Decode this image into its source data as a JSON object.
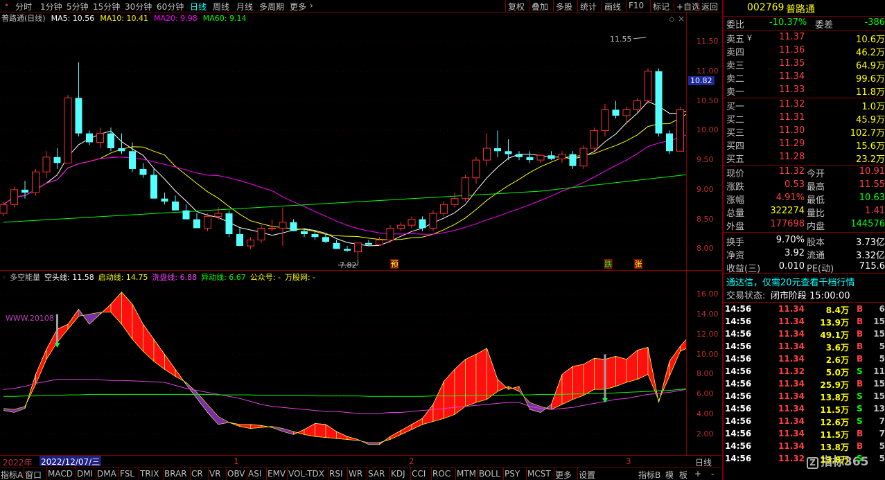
{
  "periods": [
    "分时",
    "1分钟",
    "5分钟",
    "15分钟",
    "30分钟",
    "60分钟",
    "日线",
    "周线",
    "月线",
    "多周期",
    "更多"
  ],
  "active_period": "日线",
  "tools": [
    "复权",
    "叠加",
    "多股",
    "统计",
    "画线",
    "F10",
    "标记",
    "+自选",
    "返回"
  ],
  "main_legend": {
    "name": "普路通(日线)",
    "ma5": "MA5: 10.56",
    "ma10": "MA10: 10.41",
    "ma20": "MA20: 9.98",
    "ma60": "MA60: 9.14"
  },
  "annotations": {
    "high": "11.55",
    "low": "7.82",
    "yu": "预",
    "die": "跌",
    "zhang": "张",
    "price_tag": "10.82"
  },
  "main_yticks": [
    "11.50",
    "11.00",
    "10.50",
    "10.00",
    "9.50",
    "9.00",
    "8.50",
    "8.00"
  ],
  "ind_yticks": [
    "16.00",
    "14.00",
    "12.00",
    "10.00",
    "8.00",
    "6.00",
    "4.00",
    "2.00"
  ],
  "ind_legend": {
    "name": "多空能量",
    "kongtou": "空头线: 11.58",
    "qidong": "启动线: 14.75",
    "xipan": "洗盘线: 6.88",
    "yidong": "异动线: 6.67",
    "gongzhong": "公众号: -",
    "wangu": "万股网: -",
    "watermark": "WWW.20108"
  },
  "timebar": {
    "year": "2022年",
    "date": "2022/12/07/三",
    "m1": "1",
    "m2": "2",
    "m3": "3",
    "period_label": "日线"
  },
  "tabs": [
    "指标A",
    "窗口",
    "MACD",
    "DMI",
    "DMA",
    "FSL",
    "TRIX",
    "BRAR",
    "CR",
    "VR",
    "OBV",
    "ASI",
    "EMV",
    "VOL-TDX",
    "RSI",
    "WR",
    "SAR",
    "KDJ",
    "CCI",
    "ROC",
    "MTM",
    "BOLL",
    "PSY",
    "MCST",
    "更多",
    "设置"
  ],
  "tabs_right": [
    "指标B",
    "模",
    "板",
    "+",
    "-"
  ],
  "stock": {
    "code": "002769",
    "name": "普路通"
  },
  "weibi": {
    "label": "委比",
    "value": "-10.37%",
    "label2": "委差",
    "value2": "-386"
  },
  "asks": [
    {
      "label": "卖五",
      "mark": "￥",
      "price": "11.37",
      "vol": "10.6万"
    },
    {
      "label": "卖四",
      "mark": "",
      "price": "11.36",
      "vol": "46.2万"
    },
    {
      "label": "卖三",
      "mark": "",
      "price": "11.35",
      "vol": "64.9万"
    },
    {
      "label": "卖二",
      "mark": "",
      "price": "11.34",
      "vol": "99.6万"
    },
    {
      "label": "卖一",
      "mark": "",
      "price": "11.33",
      "vol": "11.8万"
    }
  ],
  "bids": [
    {
      "label": "买一",
      "price": "11.32",
      "vol": "1.0万"
    },
    {
      "label": "买二",
      "price": "11.31",
      "vol": "45.9万"
    },
    {
      "label": "买三",
      "price": "11.30",
      "vol": "102.7万"
    },
    {
      "label": "买四",
      "price": "11.29",
      "vol": "15.6万"
    },
    {
      "label": "买五",
      "price": "11.28",
      "vol": "23.2万"
    }
  ],
  "stats": [
    {
      "l1": "现价",
      "v1": "11.32",
      "c1": "red",
      "l2": "今开",
      "v2": "10.91",
      "c2": "red"
    },
    {
      "l1": "涨跌",
      "v1": "0.53",
      "c1": "red",
      "l2": "最高",
      "v2": "11.55",
      "c2": "red"
    },
    {
      "l1": "涨幅",
      "v1": "4.91%",
      "c1": "red",
      "l2": "最低",
      "v2": "10.63",
      "c2": "green"
    },
    {
      "l1": "总量",
      "v1": "322274",
      "c1": "yellow",
      "l2": "量比",
      "v2": "1.41",
      "c2": "red"
    },
    {
      "l1": "外盘",
      "v1": "177698",
      "c1": "red",
      "l2": "内盘",
      "v2": "144576",
      "c2": "green"
    },
    {
      "l1": "换手",
      "v1": "9.70%",
      "c1": "white",
      "l2": "股本",
      "v2": "3.73亿",
      "c2": "white"
    },
    {
      "l1": "净资",
      "v1": "3.92",
      "c1": "white",
      "l2": "流通",
      "v2": "3.32亿",
      "c2": "white"
    },
    {
      "l1": "收益(三)",
      "v1": "0.010",
      "c1": "white",
      "l2": "PE(动)",
      "v2": "715.6",
      "c2": "white"
    }
  ],
  "promo": "通达信，仅需20元查看千档行情",
  "trade_state": {
    "label": "交易状态:",
    "value": "闭市阶段 15:00:00"
  },
  "ticks": [
    {
      "t": "14:56",
      "p": "11.34",
      "v": "8.4万",
      "d": "B",
      "n": "6"
    },
    {
      "t": "14:56",
      "p": "11.34",
      "v": "13.9万",
      "d": "B",
      "n": "15"
    },
    {
      "t": "14:56",
      "p": "11.34",
      "v": "49.1万",
      "d": "B",
      "n": "15"
    },
    {
      "t": "14:56",
      "p": "11.34",
      "v": "3.6万",
      "d": "B",
      "n": "5"
    },
    {
      "t": "14:56",
      "p": "11.34",
      "v": "2.6万",
      "d": "B",
      "n": "5"
    },
    {
      "t": "14:56",
      "p": "11.32",
      "v": "5.0万",
      "d": "S",
      "n": "11"
    },
    {
      "t": "14:56",
      "p": "11.34",
      "v": "25.9万",
      "d": "B",
      "n": "15"
    },
    {
      "t": "14:56",
      "p": "11.34",
      "v": "13.8万",
      "d": "S",
      "n": "15"
    },
    {
      "t": "14:56",
      "p": "11.34",
      "v": "11.5万",
      "d": "S",
      "n": "13"
    },
    {
      "t": "14:56",
      "p": "11.34",
      "v": "12.6万",
      "d": "S",
      "n": "7"
    },
    {
      "t": "14:56",
      "p": "11.34",
      "v": "11.5万",
      "d": "B",
      "n": "7"
    },
    {
      "t": "14:56",
      "p": "11.34",
      "v": "13.8万",
      "d": "B",
      "n": "5"
    },
    {
      "t": "14:56",
      "p": "11.32",
      "v": "13.8万",
      "d": "S",
      "n": "5"
    }
  ],
  "watermark_logo": "指标365",
  "colors": {
    "up": "#ff3030",
    "down": "#54ffff",
    "ma5": "#ffffff",
    "ma10": "#ffff00",
    "ma20": "#ff00ff",
    "ma60": "#00ff00",
    "bear_fill": "#7a2fa8",
    "border": "#800000"
  },
  "candles": [
    [
      8.6,
      8.8,
      8.55,
      8.75
    ],
    [
      8.75,
      9.05,
      8.7,
      9.0
    ],
    [
      9.0,
      9.15,
      8.85,
      8.95
    ],
    [
      8.95,
      9.35,
      8.9,
      9.3
    ],
    [
      9.3,
      9.65,
      9.2,
      9.55
    ],
    [
      9.55,
      9.7,
      9.35,
      9.45
    ],
    [
      9.45,
      10.6,
      9.45,
      10.55
    ],
    [
      10.55,
      11.15,
      9.9,
      9.95
    ],
    [
      9.95,
      10.0,
      9.75,
      9.8
    ],
    [
      9.8,
      10.05,
      9.7,
      9.95
    ],
    [
      9.95,
      10.05,
      9.65,
      9.7
    ],
    [
      9.7,
      9.95,
      9.6,
      9.65
    ],
    [
      9.65,
      9.8,
      9.3,
      9.35
    ],
    [
      9.35,
      9.45,
      9.2,
      9.25
    ],
    [
      9.25,
      9.35,
      8.85,
      8.85
    ],
    [
      8.85,
      8.95,
      8.75,
      8.8
    ],
    [
      8.8,
      8.9,
      8.65,
      8.65
    ],
    [
      8.65,
      8.75,
      8.5,
      8.5
    ],
    [
      8.5,
      8.6,
      8.35,
      8.35
    ],
    [
      8.35,
      8.6,
      8.3,
      8.55
    ],
    [
      8.55,
      8.7,
      8.5,
      8.6
    ],
    [
      8.6,
      8.65,
      8.2,
      8.25
    ],
    [
      8.25,
      8.35,
      8.05,
      8.05
    ],
    [
      8.05,
      8.2,
      8.0,
      8.15
    ],
    [
      8.15,
      8.4,
      8.1,
      8.35
    ],
    [
      8.35,
      8.5,
      8.3,
      8.35
    ],
    [
      8.35,
      8.7,
      8.05,
      8.45
    ],
    [
      8.45,
      8.5,
      8.3,
      8.3
    ],
    [
      8.3,
      8.35,
      8.2,
      8.25
    ],
    [
      8.25,
      8.3,
      8.15,
      8.2
    ],
    [
      8.2,
      8.25,
      8.1,
      8.12
    ],
    [
      8.1,
      8.15,
      8.0,
      8.0
    ],
    [
      8.0,
      8.05,
      7.95,
      7.97
    ],
    [
      7.95,
      8.1,
      7.82,
      8.1
    ],
    [
      8.1,
      8.15,
      8.05,
      8.07
    ],
    [
      8.07,
      8.2,
      8.05,
      8.15
    ],
    [
      8.15,
      8.4,
      8.1,
      8.35
    ],
    [
      8.35,
      8.45,
      8.3,
      8.4
    ],
    [
      8.4,
      8.55,
      8.35,
      8.5
    ],
    [
      8.5,
      8.55,
      8.3,
      8.35
    ],
    [
      8.35,
      8.65,
      8.3,
      8.6
    ],
    [
      8.6,
      8.8,
      8.55,
      8.75
    ],
    [
      8.75,
      8.95,
      8.7,
      8.85
    ],
    [
      8.85,
      9.25,
      8.8,
      9.2
    ],
    [
      9.2,
      9.55,
      9.1,
      9.5
    ],
    [
      9.5,
      9.95,
      9.4,
      9.7
    ],
    [
      9.7,
      10.0,
      9.55,
      9.65
    ],
    [
      9.65,
      9.85,
      9.5,
      9.6
    ],
    [
      9.6,
      9.65,
      9.5,
      9.55
    ],
    [
      9.55,
      9.65,
      9.45,
      9.5
    ],
    [
      9.5,
      9.6,
      9.45,
      9.58
    ],
    [
      9.58,
      9.65,
      9.5,
      9.52
    ],
    [
      9.52,
      9.65,
      9.45,
      9.6
    ],
    [
      9.6,
      9.65,
      9.35,
      9.4
    ],
    [
      9.4,
      9.75,
      9.35,
      9.7
    ],
    [
      9.7,
      10.05,
      9.65,
      10.0
    ],
    [
      10.0,
      10.45,
      9.9,
      10.35
    ],
    [
      10.35,
      10.5,
      10.2,
      10.25
    ],
    [
      10.25,
      10.4,
      10.1,
      10.35
    ],
    [
      10.35,
      10.55,
      10.3,
      10.5
    ],
    [
      10.5,
      11.05,
      10.45,
      11.0
    ],
    [
      11.0,
      11.05,
      9.9,
      9.95
    ],
    [
      9.95,
      10.0,
      9.6,
      9.65
    ],
    [
      9.65,
      10.4,
      9.7,
      10.35
    ],
    [
      10.35,
      10.9,
      10.3,
      10.82
    ],
    [
      10.91,
      11.55,
      10.63,
      11.32
    ]
  ],
  "ind_series": {
    "kong": [
      4.6,
      4.5,
      4.8,
      7.0,
      9.5,
      11.2,
      12.5,
      13.8,
      14.0,
      14.2,
      14.2,
      13.0,
      11.5,
      10.3,
      9.3,
      8.5,
      7.8,
      7.2,
      6.2,
      5.0,
      3.8,
      3.2,
      2.8,
      2.6,
      2.7,
      2.8,
      2.6,
      2.3,
      2.0,
      1.8,
      1.7,
      1.6,
      1.5,
      1.4,
      1.2,
      1.2,
      1.5,
      2.0,
      2.5,
      3.0,
      3.3,
      3.6,
      4.0,
      4.8,
      5.2,
      5.5,
      6.3,
      6.8,
      6.3,
      5.2,
      4.8,
      4.5,
      5.0,
      5.5,
      5.9,
      6.5,
      6.5,
      6.8,
      7.2,
      7.5,
      8.0,
      5.4,
      7.8,
      10.3,
      10.8,
      11.58
    ],
    "qidong": [
      4.4,
      4.2,
      4.6,
      8.0,
      10.5,
      12.5,
      13.0,
      14.5,
      13.0,
      14.0,
      15.0,
      16.2,
      15.0,
      13.0,
      11.5,
      10.0,
      8.5,
      7.0,
      5.6,
      4.2,
      3.0,
      3.2,
      3.0,
      3.0,
      2.9,
      2.7,
      2.3,
      2.0,
      2.5,
      3.1,
      3.0,
      2.3,
      1.8,
      1.5,
      1.0,
      1.0,
      1.8,
      2.4,
      3.0,
      3.6,
      5.0,
      7.3,
      8.5,
      9.5,
      10.0,
      10.6,
      7.5,
      6.5,
      6.8,
      4.5,
      4.2,
      5.0,
      8.0,
      8.8,
      9.0,
      9.6,
      9.5,
      9.8,
      9.5,
      10.4,
      10.7,
      5.2,
      9.3,
      10.8,
      12.0,
      14.75
    ],
    "xipan": [
      6.5,
      6.6,
      6.8,
      7.1,
      7.3,
      7.5,
      7.5,
      7.5,
      7.5,
      7.45,
      7.4,
      7.4,
      7.35,
      7.3,
      7.25,
      7.2,
      6.9,
      6.6,
      6.4,
      6.2,
      6.0,
      5.8,
      5.6,
      5.3,
      5.0,
      4.8,
      4.7,
      4.6,
      4.5,
      4.4,
      4.3,
      4.3,
      4.2,
      4.1,
      4.1,
      4.1,
      4.2,
      4.2,
      4.3,
      4.4,
      4.5,
      4.6,
      4.7,
      4.8,
      4.9,
      5.0,
      5.1,
      5.2,
      5.2,
      4.8,
      4.6,
      4.5,
      4.6,
      4.7,
      4.9,
      5.1,
      5.3,
      5.5,
      5.6,
      5.8,
      6.0,
      6.1,
      6.2,
      6.4,
      6.6,
      6.88
    ],
    "yidong": [
      5.8,
      5.8,
      5.85,
      5.85,
      5.9,
      5.9,
      5.95,
      5.95,
      6.0,
      6.0,
      6.0,
      6.0,
      6.0,
      6.0,
      6.0,
      6.0,
      6.0,
      6.0,
      6.0,
      6.0,
      5.95,
      5.95,
      5.95,
      5.95,
      5.9,
      5.9,
      5.9,
      5.9,
      5.9,
      5.85,
      5.85,
      5.85,
      5.85,
      5.85,
      5.8,
      5.8,
      5.8,
      5.8,
      5.8,
      5.8,
      5.85,
      5.85,
      5.85,
      5.9,
      5.9,
      5.9,
      5.9,
      5.95,
      5.95,
      5.95,
      6.0,
      6.0,
      6.0,
      6.05,
      6.05,
      6.1,
      6.1,
      6.15,
      6.2,
      6.25,
      6.3,
      6.35,
      6.4,
      6.5,
      6.6,
      6.67
    ]
  }
}
